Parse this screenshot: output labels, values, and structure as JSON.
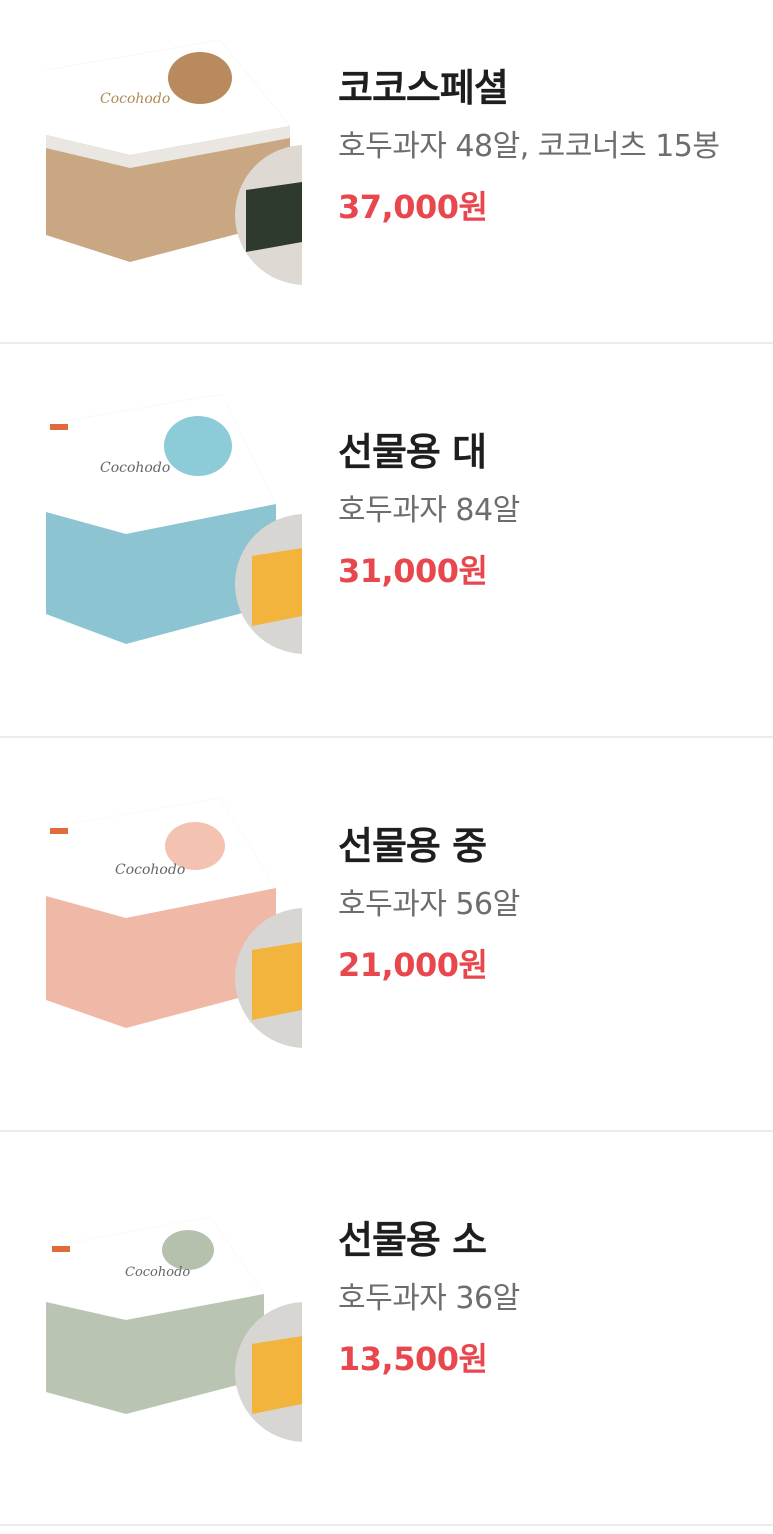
{
  "products": [
    {
      "name": "코코스페셜",
      "desc": "호두과자 48알, 코코너츠 15봉",
      "price": "37,000원",
      "box_color": "#c9a783",
      "blob_color": "#b98a5e",
      "inset_color": "#2f3a2e",
      "logo_text": "Cocohodo"
    },
    {
      "name": "선물용 대",
      "desc": "호두과자 84알",
      "price": "31,000원",
      "box_color": "#8cc4d2",
      "blob_color": "#8ccbd8",
      "inset_color": "#f2b43c",
      "logo_text": "Cocohodo"
    },
    {
      "name": "선물용 중",
      "desc": "호두과자 56알",
      "price": "21,000원",
      "box_color": "#f0b8a6",
      "blob_color": "#f3c2b1",
      "inset_color": "#f2b43c",
      "logo_text": "Cocohodo"
    },
    {
      "name": "선물용 소",
      "desc": "호두과자 36알",
      "price": "13,500원",
      "box_color": "#b9c4b2",
      "blob_color": "#b5c0ad",
      "inset_color": "#f2b43c",
      "logo_text": "Cocohodo"
    }
  ],
  "accent": "#e8474e"
}
